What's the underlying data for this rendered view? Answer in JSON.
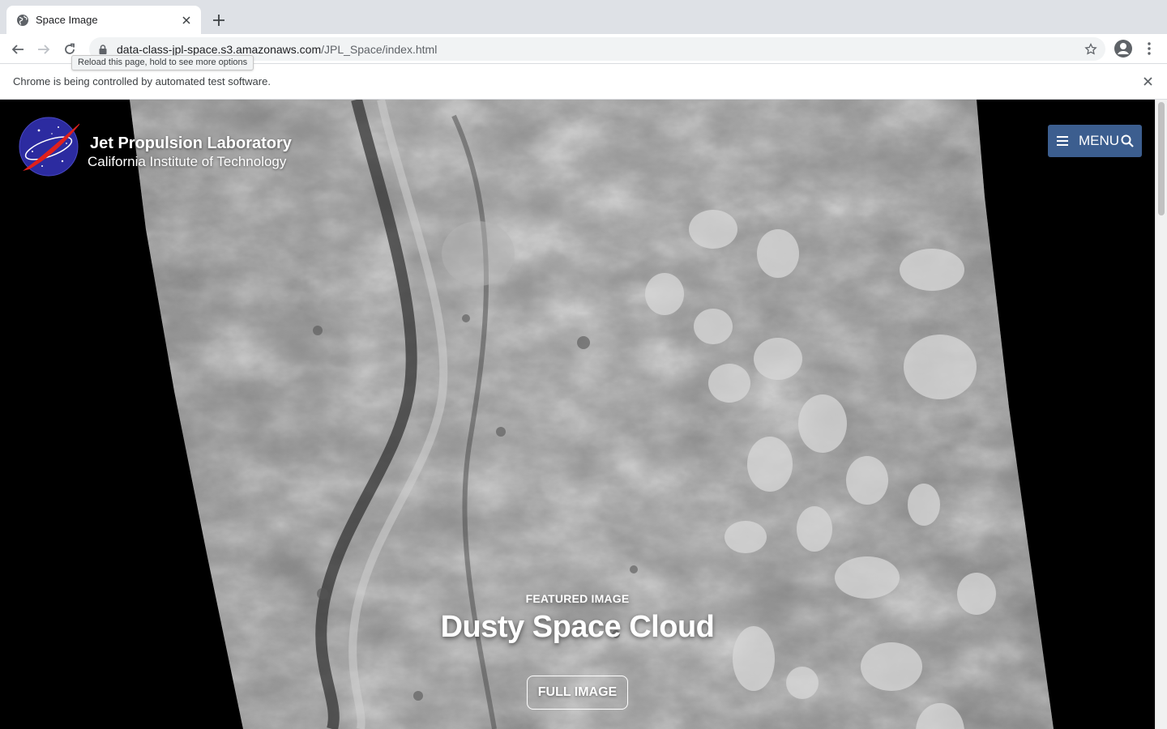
{
  "browser": {
    "tab": {
      "title": "Space Image"
    },
    "url": {
      "host": "data-class-jpl-space.s3.amazonaws.com",
      "path": "/JPL_Space/index.html"
    },
    "tooltip": "Reload this page, hold to see more options",
    "infobar": {
      "message": "Chrome is being controlled by automated test software."
    },
    "icons": {
      "favicon": "globe-icon",
      "tab_close": "close-icon",
      "new_tab": "plus-icon",
      "back": "arrow-left-icon",
      "forward": "arrow-right-icon",
      "reload": "reload-icon",
      "lock": "lock-icon",
      "bookmark": "star-icon",
      "profile": "account-icon",
      "menu": "kebab-icon",
      "infobar_close": "close-icon"
    }
  },
  "header": {
    "org_name": "Jet Propulsion Laboratory",
    "institution": "California Institute of Technology",
    "menu_label": "MENU",
    "icons": {
      "logo": "nasa-meatball-logo",
      "menu": "hamburger-icon",
      "search": "search-icon"
    },
    "menu_color": "#3c5e8f"
  },
  "hero": {
    "kicker": "FEATURED IMAGE",
    "title": "Dusty Space Cloud",
    "button_label": "FULL IMAGE"
  }
}
